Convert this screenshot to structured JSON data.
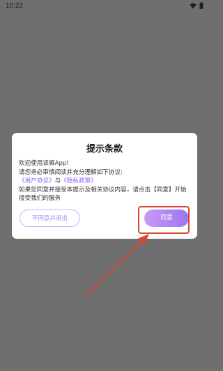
{
  "status_bar": {
    "time": "10:22",
    "icons": [
      "wifi-icon",
      "battery-icon"
    ]
  },
  "dialog": {
    "title": "提示条款",
    "welcome": "欢迎使用读嘛App!",
    "intro": "请您务必审慎阅读并充分理解如下协议:",
    "user_agreement_link": "《用户协议》",
    "conjunction": "与",
    "privacy_policy_link": "《隐私政策》",
    "consent_text": "如果您同意并接受本提示及相关协议内容，请点击【同意】开始接受我们的服务",
    "decline_button": "不同意并退出",
    "agree_button": "同意"
  },
  "colors": {
    "overlay": "#6f6f6f",
    "accent": "#8d5cf6",
    "annotation": "#d9472f"
  }
}
